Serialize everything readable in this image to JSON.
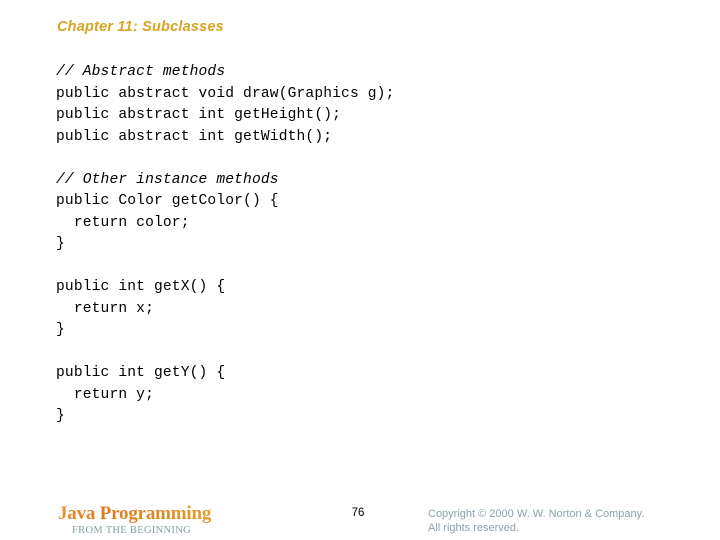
{
  "slide": {
    "title": "Chapter 11: Subclasses",
    "title_color": "#d9a520",
    "background_color": "#ffffff"
  },
  "code": {
    "text_color": "#000000",
    "lines": [
      {
        "text": "// Abstract methods",
        "style": "comment"
      },
      {
        "text": "public abstract void draw(Graphics g);",
        "style": "code"
      },
      {
        "text": "public abstract int getHeight();",
        "style": "code"
      },
      {
        "text": "public abstract int getWidth();",
        "style": "code"
      },
      {
        "text": "",
        "style": "blank"
      },
      {
        "text": "// Other instance methods",
        "style": "comment"
      },
      {
        "text": "public Color getColor() {",
        "style": "code"
      },
      {
        "text": "  return color;",
        "style": "code"
      },
      {
        "text": "}",
        "style": "code"
      },
      {
        "text": "",
        "style": "blank"
      },
      {
        "text": "public int getX() {",
        "style": "code"
      },
      {
        "text": "  return x;",
        "style": "code"
      },
      {
        "text": "}",
        "style": "code"
      },
      {
        "text": "",
        "style": "blank"
      },
      {
        "text": "public int getY() {",
        "style": "code"
      },
      {
        "text": "  return y;",
        "style": "code"
      },
      {
        "text": "}",
        "style": "code"
      }
    ]
  },
  "footer": {
    "brand_title": "Java Programming",
    "brand_subtitle": "FROM THE BEGINNING",
    "brand_title_gradient_start": "#e8922c",
    "brand_title_gradient_end": "#f0c233",
    "brand_subtitle_color": "#82a0a2",
    "page_number": "76",
    "copyright_line1": "Copyright © 2000 W. W. Norton & Company.",
    "copyright_line2": "All rights reserved.",
    "copyright_color": "#8aa3ac"
  }
}
